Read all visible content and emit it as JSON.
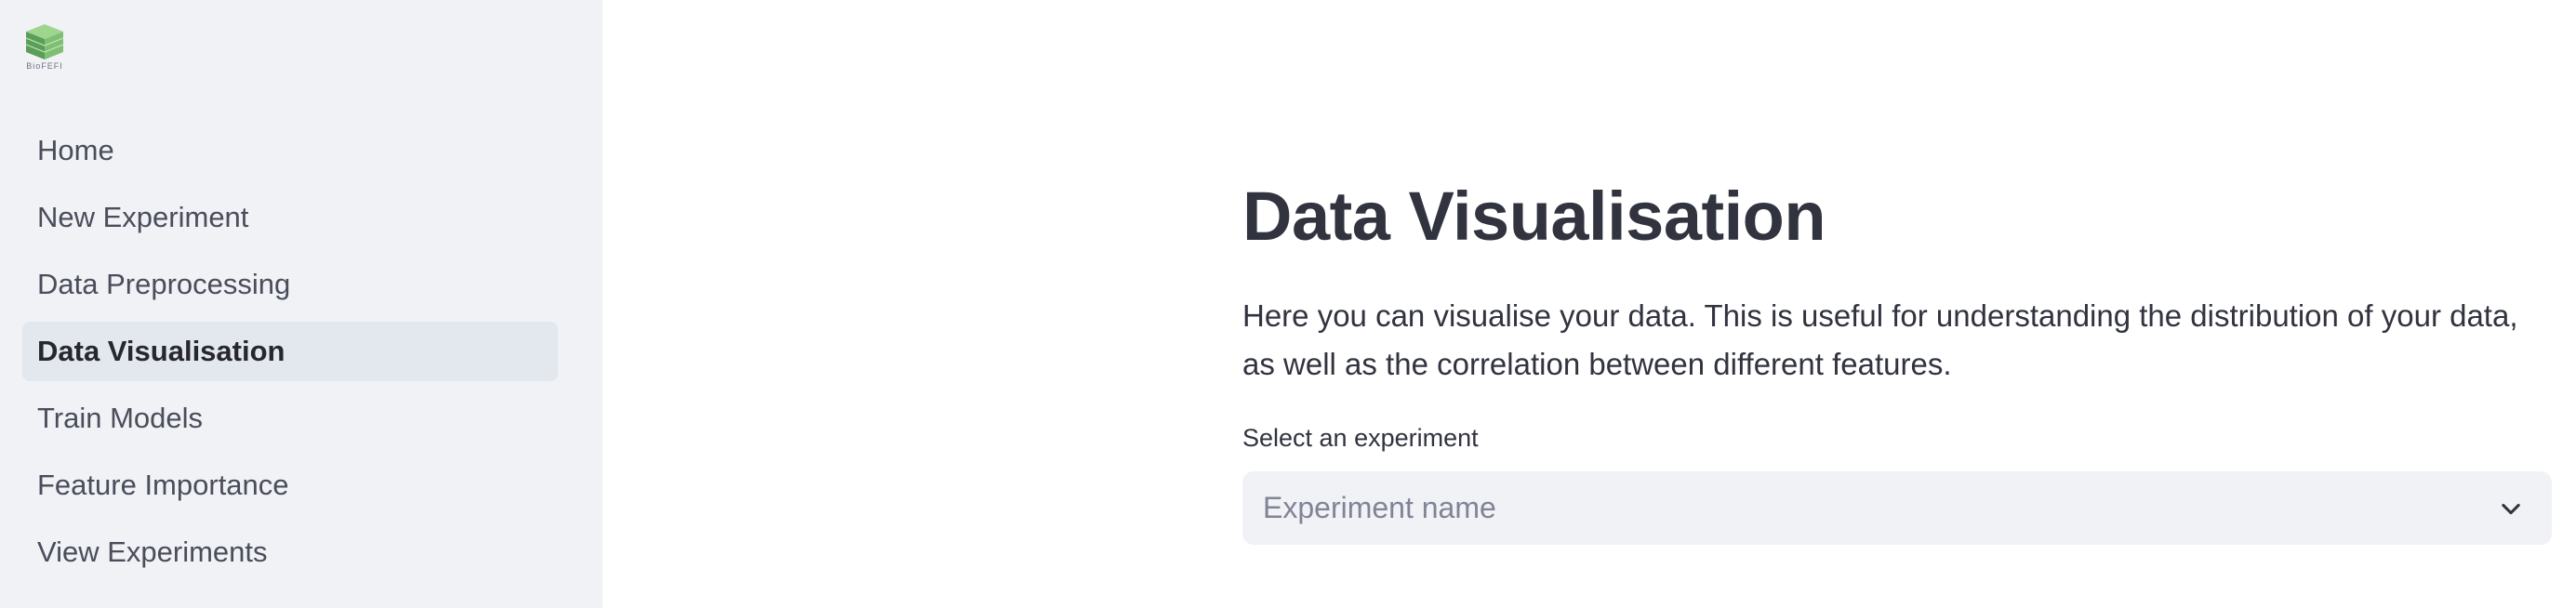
{
  "sidebar": {
    "logo": {
      "icon": "cube-logo-icon",
      "text": "BioFEFI"
    },
    "items": [
      {
        "label": "Home"
      },
      {
        "label": "New Experiment"
      },
      {
        "label": "Data Preprocessing"
      },
      {
        "label": "Data Visualisation",
        "active": true
      },
      {
        "label": "Train Models"
      },
      {
        "label": "Feature Importance"
      },
      {
        "label": "View Experiments"
      }
    ]
  },
  "main": {
    "title": "Data Visualisation",
    "description": "Here you can visualise your data. This is useful for understanding the distribution of your data, as well as the correlation between different features.",
    "select": {
      "label": "Select an experiment",
      "placeholder": "Experiment name",
      "icon": "chevron-down-icon"
    }
  },
  "colors": {
    "sidebar_bg": "#f0f2f6",
    "active_item_bg": "#e3e7ee",
    "text": "#31333f",
    "placeholder": "#808495"
  }
}
